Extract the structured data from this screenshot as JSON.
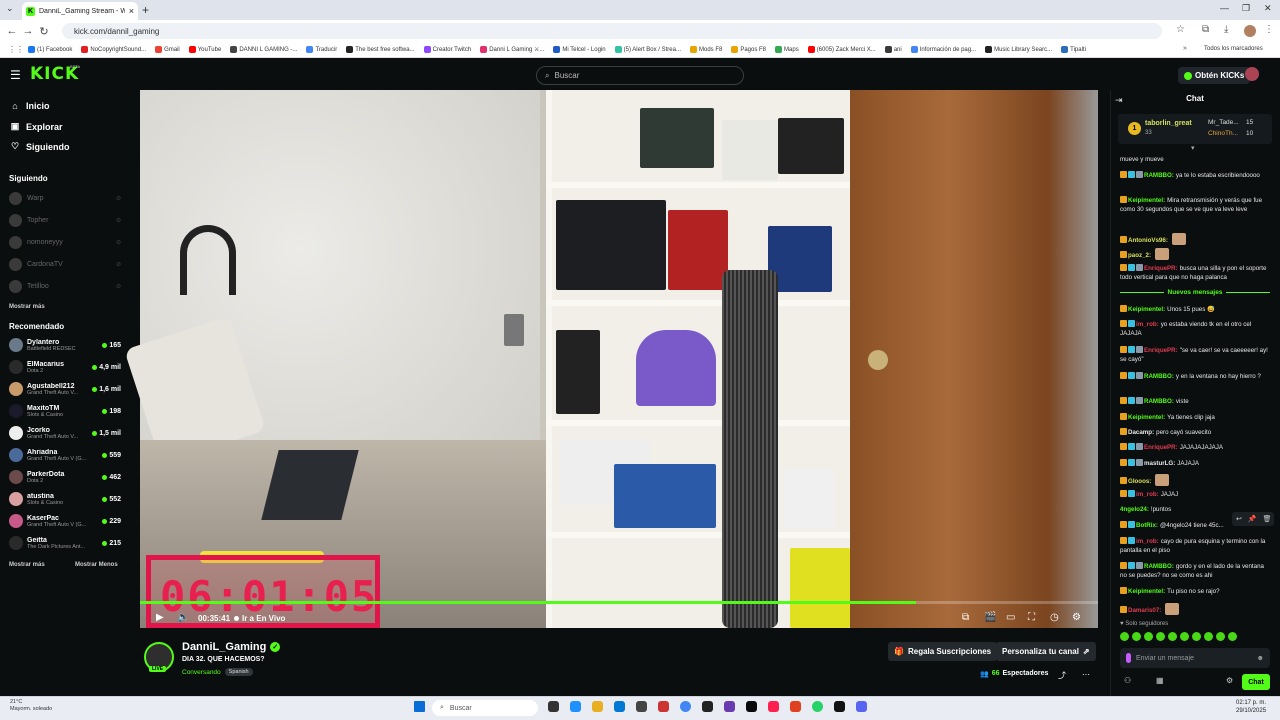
{
  "browser": {
    "tab_title": "DanniL_Gaming Stream - Watc",
    "tab_favicon": "K",
    "url": "kick.com/dannil_gaming",
    "bookmarks": [
      {
        "label": "(1) Facebook",
        "color": "#1877f2"
      },
      {
        "label": "NoCopyrightSound...",
        "color": "#e02020"
      },
      {
        "label": "Gmail",
        "color": "#ea4335"
      },
      {
        "label": "YouTube",
        "color": "#ff0000"
      },
      {
        "label": "DANNI L GAMING -...",
        "color": "#444444"
      },
      {
        "label": "Traducir",
        "color": "#4285f4"
      },
      {
        "label": "The best free softwa...",
        "color": "#222222"
      },
      {
        "label": "Creator Twitch",
        "color": "#9146ff"
      },
      {
        "label": "Danni L Gaming ⚔...",
        "color": "#e1306c"
      },
      {
        "label": "Mi Telcel - Login",
        "color": "#1e5bc6"
      },
      {
        "label": "(5) Alert Box / Strea...",
        "color": "#31c3a2"
      },
      {
        "label": "Mods F8",
        "color": "#e8a400"
      },
      {
        "label": "Pagos F8",
        "color": "#e8a400"
      },
      {
        "label": "Maps",
        "color": "#34a853"
      },
      {
        "label": "(6005) Zack Merci X...",
        "color": "#ff0000"
      },
      {
        "label": "ani",
        "color": "#3a3a3a"
      },
      {
        "label": "Información de pag...",
        "color": "#4285f4"
      },
      {
        "label": "Music Library Searc...",
        "color": "#222222"
      },
      {
        "label": "Tipalti",
        "color": "#2a6ebb"
      }
    ],
    "all_bookmarks": "Todos los marcadores"
  },
  "header": {
    "logo": "KICK",
    "beta": "BETA",
    "search_placeholder": "Buscar",
    "get_kicks": "Obtén KICKs"
  },
  "sidebar": {
    "nav": [
      {
        "label": "Inicio",
        "icon": "⌂"
      },
      {
        "label": "Explorar",
        "icon": "▣"
      },
      {
        "label": "Siguiendo",
        "icon": "♡"
      }
    ],
    "following_heading": "Siguiendo",
    "following": [
      "Warp",
      "Topher",
      "nomoneyyy",
      "CardonaTV",
      "Tetilloo"
    ],
    "show_more": "Mostrar más",
    "recommended_heading": "Recomendado",
    "recommended": [
      {
        "name": "Dylantero",
        "category": "Battlefield REDSEC",
        "viewers": "165",
        "color": "#6a7a8a"
      },
      {
        "name": "ElMacarius",
        "category": "Dota 2",
        "viewers": "4,9 mil",
        "color": "#2a2a2a"
      },
      {
        "name": "Agustabell212",
        "category": "Grand Theft Auto V...",
        "viewers": "1,6 mil",
        "color": "#c89a6a"
      },
      {
        "name": "MaxitoTM",
        "category": "Slots & Casino",
        "viewers": "198",
        "color": "#1a1a2a"
      },
      {
        "name": "Jcorko",
        "category": "Grand Theft Auto V...",
        "viewers": "1,5 mil",
        "color": "#eeeeee"
      },
      {
        "name": "Ahriadna",
        "category": "Grand Theft Auto V (G...",
        "viewers": "559",
        "color": "#4a6a9a"
      },
      {
        "name": "ParkerDota",
        "category": "Dota 2",
        "viewers": "462",
        "color": "#6a4a4a"
      },
      {
        "name": "atustina",
        "category": "Slots & Casino",
        "viewers": "552",
        "color": "#d8a0a0"
      },
      {
        "name": "KaserPac",
        "category": "Grand Theft Auto V (G...",
        "viewers": "229",
        "color": "#c85a8a"
      },
      {
        "name": "Geitta",
        "category": "The Dark Pictures Ant...",
        "viewers": "215",
        "color": "#2a2a2a"
      }
    ],
    "show_more_2": "Mostrar más",
    "show_less": "Mostrar Menos"
  },
  "player": {
    "timer_overlay": "06:01:05",
    "elapsed": "00:35:41",
    "go_live": "Ir a En Vivo",
    "progress_fraction": 0.81
  },
  "stream": {
    "live_badge": "LIVE",
    "channel": "DanniL_Gaming",
    "title": "DIA 32. QUE HACEMOS?",
    "category": "Conversando",
    "language": "Spanish",
    "gift_subs": "Regala Suscripciones",
    "customize": "Personaliza tu canal",
    "viewers_count": "66",
    "viewers_label": "Espectadores"
  },
  "chat": {
    "title": "Chat",
    "pinned": {
      "rank": "1",
      "user": "taborlin_great",
      "count": "33",
      "user2": "Mr_Tade...",
      "count2": "15",
      "user3": "ChinoTh...",
      "count3": "10"
    },
    "new_messages": "Nuevos mensajes",
    "messages": [
      {
        "user": "",
        "text": "mueve y mueve",
        "color": "#53fc18",
        "emote": false,
        "badges": 0
      },
      {
        "user": "RAMBBO:",
        "text": "ya te lo estaba escribiendoooo",
        "color": "#53fc18",
        "emote": false,
        "badges": 3
      },
      {
        "user": "Keipimentel:",
        "text": "Mira retransmisión y verás que fue como 30 segundos que se ve que va leve leve",
        "color": "#53fc18",
        "emote": false,
        "badges": 1
      },
      {
        "user": "AntonioVs96:",
        "text": "",
        "color": "#d6e05a",
        "emote": true,
        "badges": 1
      },
      {
        "user": "paoz_2:",
        "text": "",
        "color": "#d6e05a",
        "emote": true,
        "badges": 1
      },
      {
        "user": "EnriquePR:",
        "text": "busca una silla y pon el soporte todo vertical para que no haga palanca",
        "color": "#e03c50",
        "emote": false,
        "badges": 3
      },
      {
        "user": "Keipimentel:",
        "text": "Unos 15 pues 😅",
        "color": "#53fc18",
        "emote": false,
        "badges": 1
      },
      {
        "user": "im_rob:",
        "text": "yo estaba viendo tk en el otro cel JAJAJA",
        "color": "#e03c50",
        "emote": false,
        "badges": 2
      },
      {
        "user": "EnriquePR:",
        "text": "\"se va caer! se va caeeeeer! ay! se cayó\"",
        "color": "#e03c50",
        "emote": false,
        "badges": 3
      },
      {
        "user": "RAMBBO:",
        "text": "y en la ventana no hay hierro ?",
        "color": "#53fc18",
        "emote": false,
        "badges": 3
      },
      {
        "user": "RAMBBO:",
        "text": "viste",
        "color": "#53fc18",
        "emote": false,
        "badges": 3
      },
      {
        "user": "Keipimentel:",
        "text": "Ya tienes clip jaja",
        "color": "#53fc18",
        "emote": false,
        "badges": 1
      },
      {
        "user": "Dacamp:",
        "text": "pero cayó suavecito",
        "color": "#e8e8e8",
        "emote": false,
        "badges": 1
      },
      {
        "user": "EnriquePR:",
        "text": "JAJAJAJAJAJA",
        "color": "#e03c50",
        "emote": false,
        "badges": 3
      },
      {
        "user": "masturLG:",
        "text": "JAJAJA",
        "color": "#e8e8e8",
        "emote": false,
        "badges": 3
      },
      {
        "user": "Glooos:",
        "text": "",
        "color": "#d6e05a",
        "emote": true,
        "badges": 1
      },
      {
        "user": "im_rob:",
        "text": "JAJAJ",
        "color": "#e03c50",
        "emote": false,
        "badges": 2
      },
      {
        "user": "4ngelo24:",
        "text": "!puntos",
        "color": "#53fc18",
        "emote": false,
        "badges": 0
      },
      {
        "user": "BotRix:",
        "text": "@4ngelo24 tiene 45c...",
        "color": "#53fc18",
        "emote": false,
        "badges": 2
      },
      {
        "user": "im_rob:",
        "text": "cayo de pura esquina y termino con la pantalla en el piso",
        "color": "#e03c50",
        "emote": false,
        "badges": 2
      },
      {
        "user": "RAMBBO:",
        "text": "gordo y en el lado de la ventana no se puedes? no se como es ahi",
        "color": "#53fc18",
        "emote": false,
        "badges": 3
      },
      {
        "user": "Keipimentel:",
        "text": "Tu piso no se rajo?",
        "color": "#53fc18",
        "emote": false,
        "badges": 1
      },
      {
        "user": "Damaris07:",
        "text": "",
        "color": "#e03c50",
        "emote": true,
        "badges": 1
      }
    ],
    "followers_only": "♥ Solo seguidores",
    "input_placeholder": "Enviar un mensaje",
    "send": "Chat"
  },
  "taskbar": {
    "temp": "21°C",
    "weather": "Mayorm. soleado",
    "search": "Buscar",
    "time": "02:17 p. m.",
    "date": "29/10/2025"
  }
}
